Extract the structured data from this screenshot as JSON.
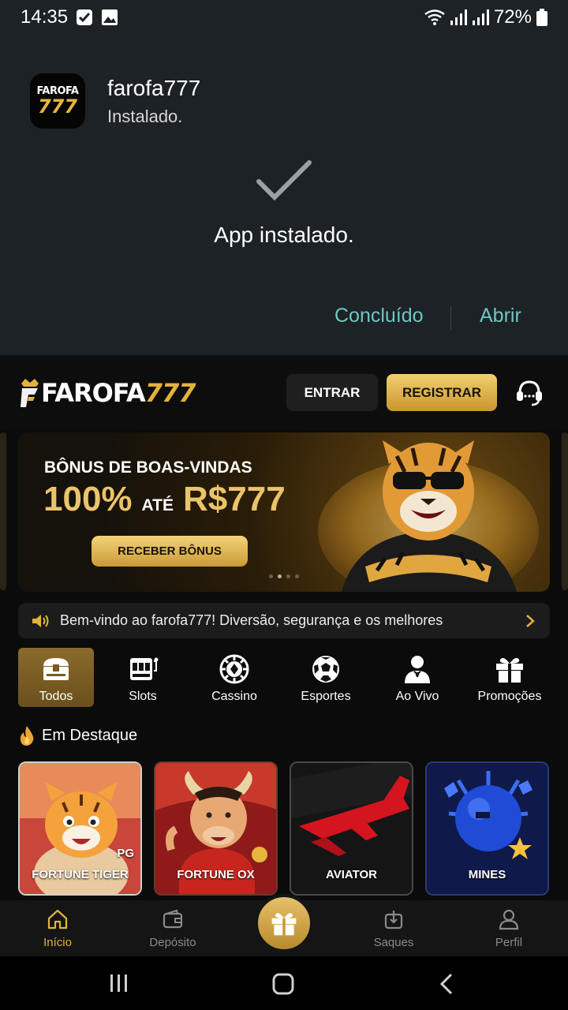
{
  "status_bar": {
    "time": "14:35",
    "battery": "72%"
  },
  "installer": {
    "app_icon": {
      "line1": "FAROFA",
      "line2": "777"
    },
    "app_name": "farofa777",
    "app_status": "Instalado.",
    "message": "App instalado.",
    "done_label": "Concluído",
    "open_label": "Abrir"
  },
  "header": {
    "logo_white": "FAROFA",
    "logo_gold": "777",
    "login_label": "ENTRAR",
    "register_label": "REGISTRAR"
  },
  "banner": {
    "title": "BÔNUS DE BOAS-VINDAS",
    "percent": "100%",
    "ate": "ATÉ",
    "amount": "R$777",
    "button_label": "RECEBER BÔNUS"
  },
  "marquee": {
    "text": "Bem-vindo ao farofa777! Diversão, segurança e os melhores"
  },
  "categories": [
    {
      "label": "Todos",
      "icon": "chest-icon"
    },
    {
      "label": "Slots",
      "icon": "slot-machine-icon"
    },
    {
      "label": "Cassino",
      "icon": "poker-chip-icon"
    },
    {
      "label": "Esportes",
      "icon": "soccer-ball-icon"
    },
    {
      "label": "Ao Vivo",
      "icon": "dealer-icon"
    },
    {
      "label": "Promoções",
      "icon": "gift-icon"
    }
  ],
  "featured": {
    "title": "Em Destaque",
    "games": [
      {
        "name": "FORTUNE TIGER",
        "badge": "PG"
      },
      {
        "name": "FORTUNE OX"
      },
      {
        "name": "AVIATOR"
      },
      {
        "name": "MINES"
      }
    ]
  },
  "bottom_nav": [
    {
      "label": "Início",
      "icon": "home-icon"
    },
    {
      "label": "Depósito",
      "icon": "wallet-icon"
    },
    {
      "label": "Saques",
      "icon": "withdraw-icon"
    },
    {
      "label": "Perfil",
      "icon": "user-icon"
    }
  ],
  "colors": {
    "gold": "#e3b23c",
    "teal": "#6ec6c2",
    "installer_bg": "#1d2226"
  }
}
